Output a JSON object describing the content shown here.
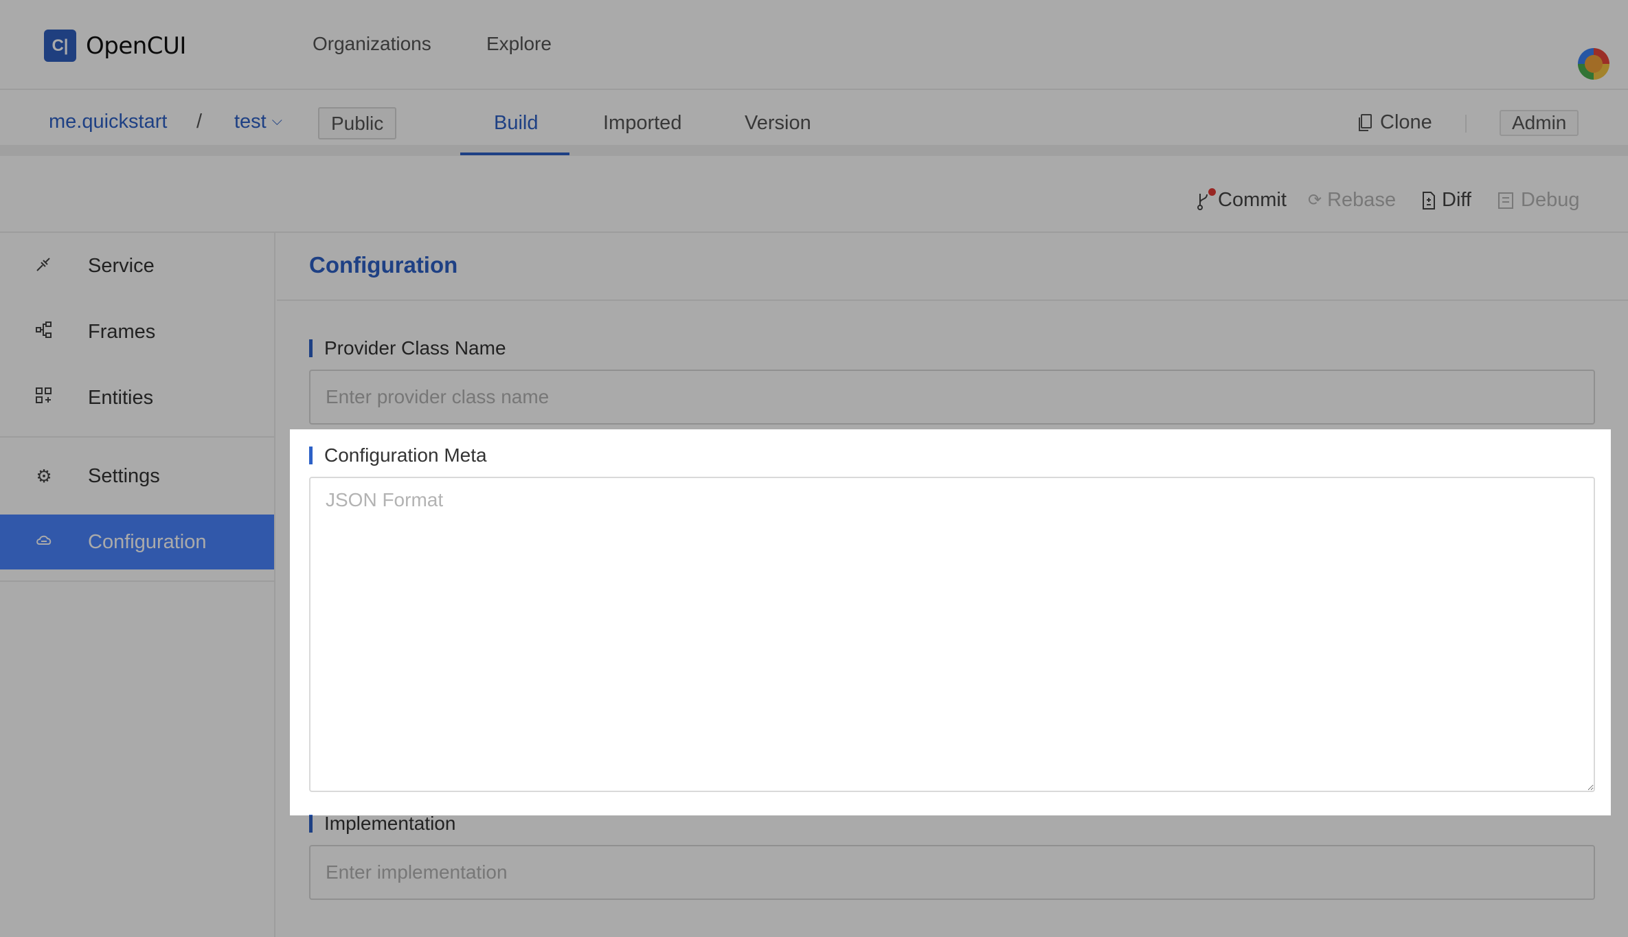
{
  "app": {
    "logo_glyph": "C|",
    "name": "OpenCUI"
  },
  "topnav": {
    "links": [
      {
        "label": "Organizations"
      },
      {
        "label": "Explore"
      }
    ]
  },
  "repo": {
    "owner": "me.quickstart",
    "separator": "/",
    "project": "test",
    "visibility": "Public",
    "tabs": [
      {
        "label": "Build",
        "active": true
      },
      {
        "label": "Imported",
        "active": false
      },
      {
        "label": "Version",
        "active": false
      }
    ],
    "clone_label": "Clone",
    "admin_label": "Admin"
  },
  "toolbar": {
    "commit_label": "Commit",
    "rebase_label": "Rebase",
    "diff_label": "Diff",
    "debug_label": "Debug"
  },
  "sidebar": {
    "items": [
      {
        "label": "Service",
        "icon": "plug-icon"
      },
      {
        "label": "Frames",
        "icon": "frames-icon"
      },
      {
        "label": "Entities",
        "icon": "entities-icon"
      },
      {
        "label": "Settings",
        "icon": "gear-icon"
      },
      {
        "label": "Configuration",
        "icon": "cloud-icon",
        "active": true
      }
    ]
  },
  "main": {
    "title": "Configuration",
    "provider_class": {
      "label": "Provider Class Name",
      "placeholder": "Enter provider class name",
      "value": ""
    },
    "config_meta": {
      "label": "Configuration Meta",
      "placeholder": "JSON Format",
      "value": ""
    },
    "implementation": {
      "label": "Implementation",
      "placeholder": "Enter implementation",
      "value": ""
    }
  },
  "colors": {
    "accent": "#2d61c7",
    "active_sidebar": "#4a85ff",
    "commit_dot": "#e53935",
    "overlay": "rgba(0,0,0,0.333)"
  }
}
